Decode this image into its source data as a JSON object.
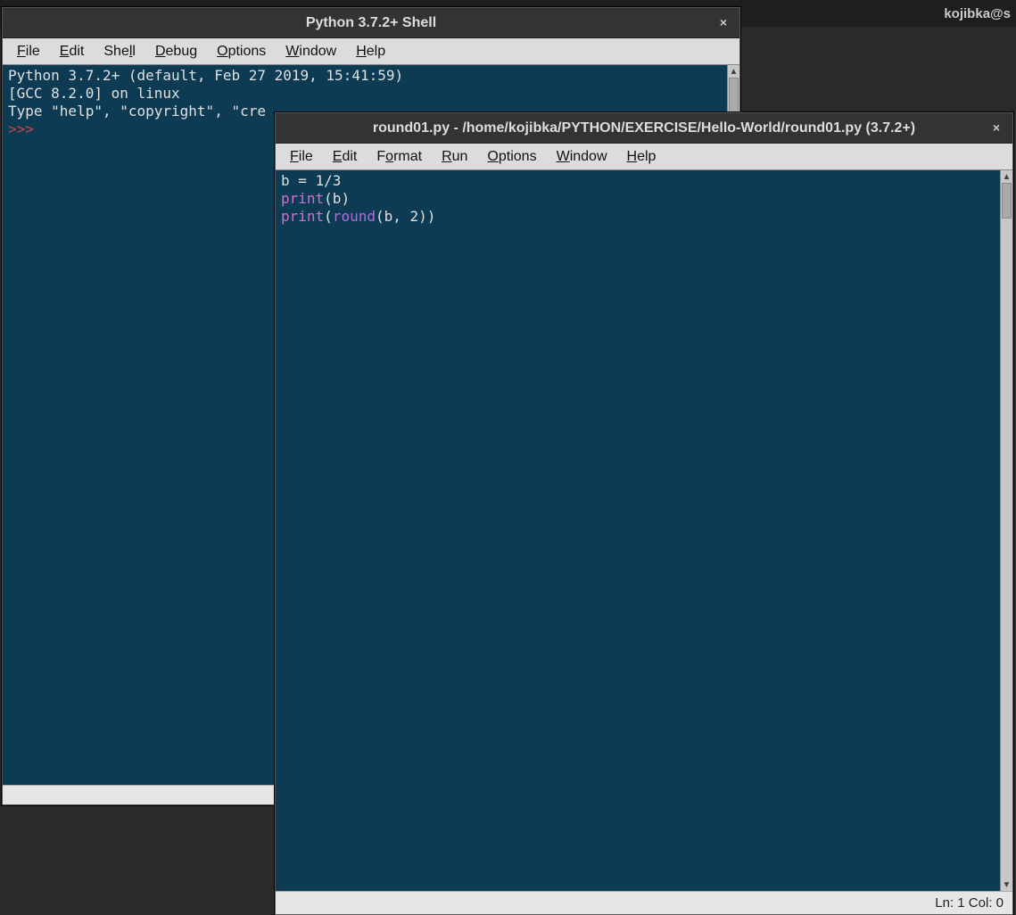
{
  "topbar": {
    "user_host": "kojibka@s"
  },
  "shell_window": {
    "title": "Python 3.7.2+ Shell",
    "close": "×",
    "menu": {
      "file": "File",
      "edit": "Edit",
      "shell": "Shell",
      "debug": "Debug",
      "options": "Options",
      "window": "Window",
      "help": "Help"
    },
    "content": {
      "line1": "Python 3.7.2+ (default, Feb 27 2019, 15:41:59) ",
      "line2": "[GCC 8.2.0] on linux",
      "line3": "Type \"help\", \"copyright\", \"cre",
      "prompt": ">>> "
    }
  },
  "editor_window": {
    "title": "round01.py - /home/kojibka/PYTHON/EXERCISE/Hello-World/round01.py (3.7.2+)",
    "close": "×",
    "menu": {
      "file": "File",
      "edit": "Edit",
      "format": "Format",
      "run": "Run",
      "options": "Options",
      "window": "Window",
      "help": "Help"
    },
    "code": {
      "l1": "b = 1/3",
      "l2_print": "print",
      "l2_rest": "(b)",
      "l3_print": "print",
      "l3_open": "(",
      "l3_round": "round",
      "l3_rest": "(b, 2))"
    },
    "status": "Ln: 1  Col: 0"
  }
}
